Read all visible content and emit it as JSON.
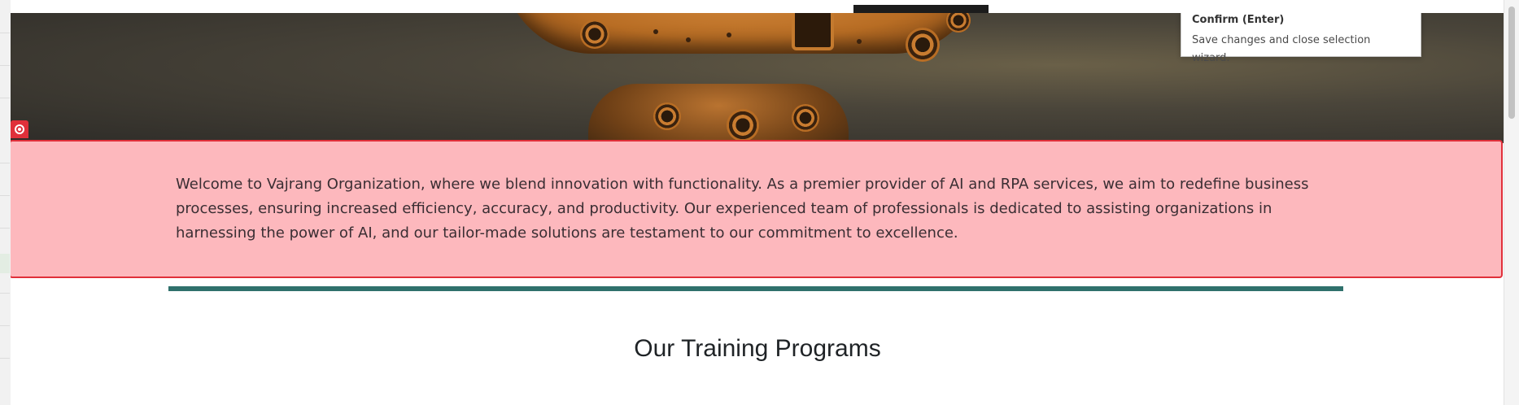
{
  "welcome": {
    "text": "Welcome to Vajrang Organization, where we blend innovation with functionality. As a premier provider of AI and RPA services, we aim to redefine business processes, ensuring increased efficiency, accuracy, and productivity. Our experienced team of professionals is dedicated to assisting organizations in harnessing the power of AI, and our tailor-made solutions are testament to our commitment to excellence."
  },
  "section": {
    "title": "Our Training Programs"
  },
  "tooltip": {
    "title": "Confirm (Enter)",
    "description": "Save changes and close selection wizard."
  },
  "icons": {
    "selection_target": "target-icon"
  },
  "colors": {
    "highlight_fill": "#fdb8bd",
    "highlight_border": "#e0303a",
    "divider": "#2f716c"
  }
}
